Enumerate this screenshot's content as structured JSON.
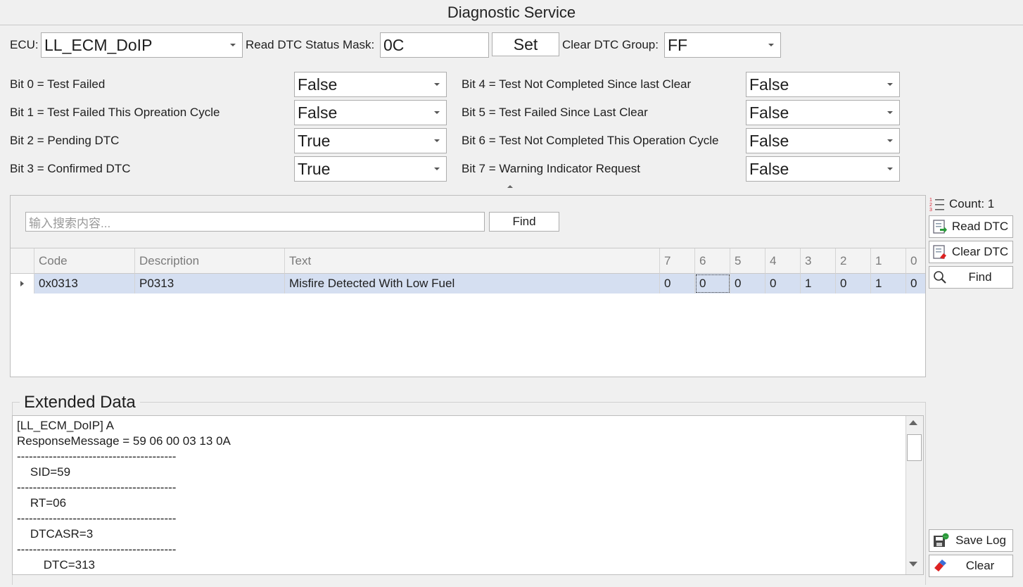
{
  "window": {
    "title": "Diagnostic Service"
  },
  "top": {
    "ecu_label": "ECU:",
    "ecu_value": "LL_ECM_DoIP",
    "mask_label": "Read DTC Status Mask:",
    "mask_value": "0C",
    "set_label": "Set",
    "clear_group_label": "Clear DTC Group:",
    "clear_group_value": "FF"
  },
  "bits": [
    {
      "label": "Bit 0 = Test Failed",
      "value": "False"
    },
    {
      "label": "Bit 1 = Test Failed This Opreation Cycle",
      "value": "False"
    },
    {
      "label": "Bit 2 = Pending DTC",
      "value": "True"
    },
    {
      "label": "Bit 3 = Confirmed DTC",
      "value": "True"
    },
    {
      "label": "Bit 4 = Test Not Completed Since last Clear",
      "value": "False"
    },
    {
      "label": "Bit 5 = Test Failed Since Last Clear",
      "value": "False"
    },
    {
      "label": "Bit 6 = Test Not Completed This Operation Cycle",
      "value": "False"
    },
    {
      "label": "Bit 7 = Warning Indicator Request",
      "value": "False"
    }
  ],
  "search": {
    "placeholder": "输入搜索内容...",
    "find_label": "Find"
  },
  "table": {
    "headers": [
      "Code",
      "Description",
      "Text",
      "7",
      "6",
      "5",
      "4",
      "3",
      "2",
      "1",
      "0"
    ],
    "rows": [
      [
        "0x0313",
        "P0313",
        "Misfire Detected With Low Fuel",
        "0",
        "0",
        "0",
        "0",
        "1",
        "0",
        "1",
        "0"
      ]
    ]
  },
  "side": {
    "count_label": "Count: 1",
    "read_dtc": "Read DTC",
    "clear_dtc": "Clear DTC",
    "find": "Find",
    "save_log": "Save Log",
    "clear": "Clear"
  },
  "extended": {
    "title": "Extended Data",
    "lines": [
      "[LL_ECM_DoIP] A",
      "ResponseMessage = 59 06 00 03 13 0A",
      "----------------------------------------",
      "    SID=59",
      "----------------------------------------",
      "    RT=06",
      "----------------------------------------",
      "    DTCASR=3",
      "----------------------------------------",
      "        DTC=313"
    ]
  },
  "colors": {
    "selected_row": "#d5dff1",
    "background": "#f0f0f0"
  }
}
